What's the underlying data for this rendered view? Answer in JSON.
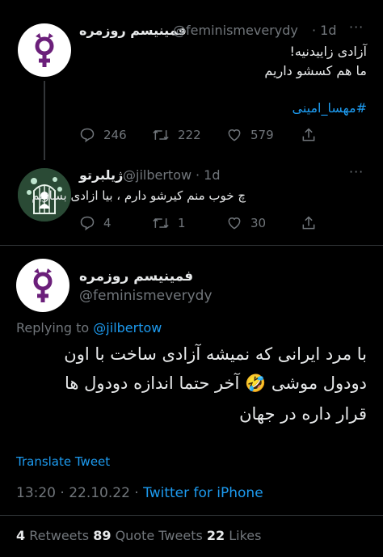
{
  "tweet1": {
    "name": "فمینیسم روزمره",
    "handle": "@feminismeverydy",
    "time": "· 1d",
    "lines": [
      "آزادی زاییدنیه!",
      "ما هم کسشو داریم"
    ],
    "hashtag": "#مهسا_امینی",
    "replies": "246",
    "retweets": "222",
    "likes": "579"
  },
  "tweet2": {
    "name": "ژیلبرتو",
    "handle": "@jilbertow",
    "time": "· 1d",
    "text": "چ خوب منم کیرشو دارم ، بیا ازادی بسازیم",
    "replies": "4",
    "retweets": "1",
    "likes": "30"
  },
  "main": {
    "name": "فمینیسم روزمره",
    "handle": "@feminismeverydy",
    "replying_prefix": "Replying to ",
    "replying_handle": "@jilbertow",
    "lines": [
      "با مرد ایرانی که نمیشه آزادی ساخت با اون",
      "دودول موشی 🤣 آخر حتما اندازه دودول ها",
      "قرار داره در جهان"
    ],
    "translate": "Translate Tweet",
    "timestamp": "13:20 · 22.10.22 · ",
    "source": "Twitter for iPhone",
    "stats": {
      "retweets_num": "4",
      "retweets_label": " Retweets ",
      "quotes_num": "89",
      "quotes_label": " Quote Tweets ",
      "likes_num": "22",
      "likes_label": " Likes"
    }
  },
  "icons": {
    "more": "more-icon",
    "reply": "reply-icon",
    "retweet": "retweet-icon",
    "like": "heart-icon",
    "share": "share-icon"
  },
  "colors": {
    "background": "#000000",
    "text": "#e7e9ea",
    "muted": "#71767b",
    "accent": "#1d9bf0",
    "logo": "#6b1f7a"
  }
}
